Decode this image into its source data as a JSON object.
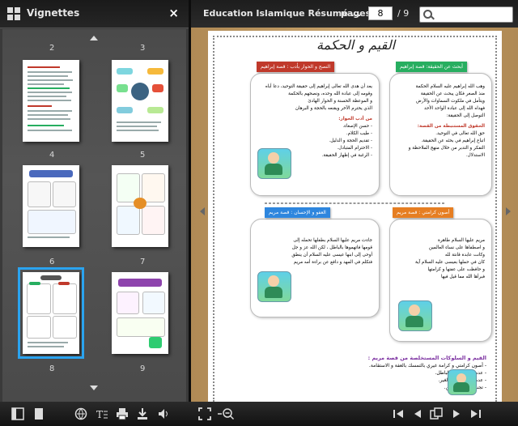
{
  "sidebar": {
    "title": "Vignettes",
    "close_symbol": "×",
    "thumbnails": [
      {
        "page": "2"
      },
      {
        "page": "3"
      },
      {
        "page": "4"
      },
      {
        "page": "5"
      },
      {
        "page": "6"
      },
      {
        "page": "7"
      },
      {
        "page": "8",
        "selected": true
      },
      {
        "page": "9"
      }
    ]
  },
  "toolbar": {
    "doc_title": "Education Islamique Résumé ...",
    "pages_label": "pages :",
    "current_page": "8",
    "total_pages": "/ 9",
    "search_placeholder": ""
  },
  "page": {
    "heading": "القيم و الحكمة",
    "tags": {
      "t1": "أبحث عن الحقيقة: قصة إبراهيم",
      "t2": "النصح و الحوار بأدب : قصة إبراهيم",
      "t3": "أصون كرامتي : قصة مريم",
      "t4": "العفو و الإحسان : قصة مريم"
    },
    "panels": {
      "p1": [
        "وهب الله إبراهيم عليه السلام الحكمة",
        "منذ الصغر فكان يبحث عن الحقيقة",
        "ويتأمل في ملكوت السماوات والأرض",
        "فهداه الله إلى عبادة الواحد الأحد",
        "التوصل إلى الحقيقة:"
      ],
      "p1_sub": "الحقوق المستنبطة من القصة:",
      "p1_list": [
        "حق الله تعالى في التوحيد.",
        "اتباع إبراهيم في بحثه عن الحقيقة.",
        "التفكر و التدبر من خلال منهج الملاحظة و الاستدلال."
      ],
      "p2": [
        "يعد أن هدى الله تعالى إبراهيم إلى حقيقة التوحيد، دعا أباه",
        "وقومه إلى عبادة الله وحده، ونصحهم بالحكمة",
        "و الموعظة الحسنة و الحوار الهادئ",
        "الذي يحترم الآخر ويقنعه بالحجة و البرهان"
      ],
      "p2_sub": "من أدب الحوار:",
      "p2_list": [
        "- حسن الإصغاء.",
        "- طيب الكلام.",
        "- تقديم الحجة و الدليل.",
        "- الاحترام المتبادل.",
        "- الرغبة في إظهار الحقيقة."
      ],
      "p3": [
        "مريم عليها السلام طاهرة",
        "و اصطفاها على نساء العالمين",
        "وكانت عابدة قانتة لله",
        "كان في حملها بعيسى عليه السلام آية",
        "و حافظت على عفتها و كرامتها",
        "فبرأها الله مما قيل فيها"
      ],
      "p4": [
        "جاءت مريم عليها السلام بطفلها تحمله إلى",
        "قومها فاتهموها بالباطل ، لكن الله عز و جل",
        "أوحى إلى ابنها عيسى عليه السلام أن ينطق",
        "فتكلم في المهد و دافع عن براءة أمه مريم"
      ]
    },
    "bottom": {
      "heading": "القيم و السلوكات المستخلصة من قصة مريم :",
      "items": [
        "- أصون كرامتي و كرامة غيري بالتمسك بالعفة و الاستقامة.",
        "- عدم اتهام الغير بالباطل.",
        "- عدم سوء الظن بالغير.",
        "- تجنب إيذاء الآخرين."
      ]
    }
  },
  "bottom_toolbar": {
    "left_buttons": [
      "sidebar-toggle-icon",
      "single-page-icon",
      "share-icon",
      "text-select-icon",
      "print-icon",
      "download-icon",
      "volume-icon",
      "fullscreen-icon",
      "zoom-out-icon"
    ],
    "right_buttons": [
      "first-page-icon",
      "previous-page-icon",
      "double-page-icon",
      "next-page-icon",
      "last-page-icon"
    ]
  }
}
